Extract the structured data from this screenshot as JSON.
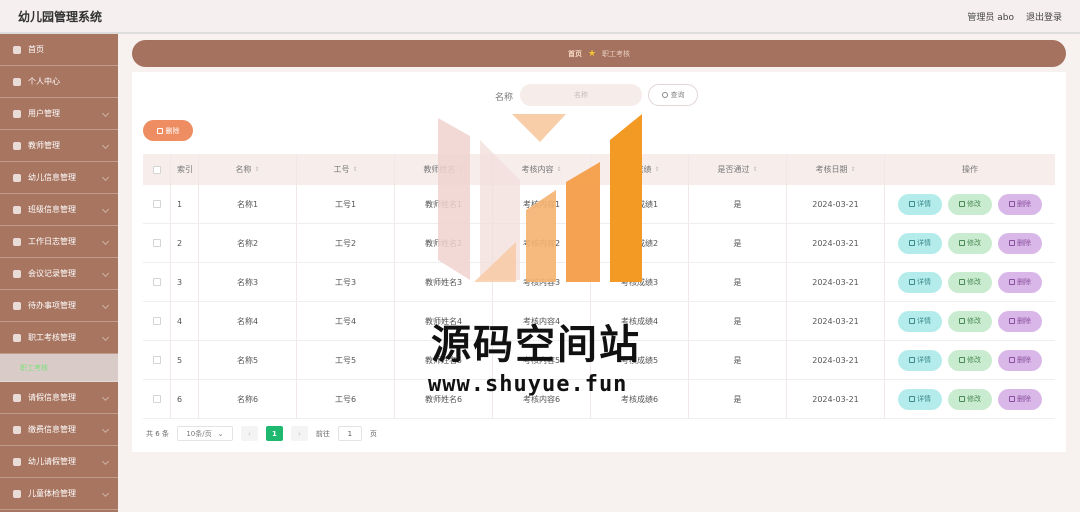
{
  "header": {
    "app_title": "幼儿园管理系统",
    "user_label": "管理员 abo",
    "logout_label": "退出登录"
  },
  "sidebar": {
    "items": [
      {
        "label": "首页"
      },
      {
        "label": "个人中心"
      },
      {
        "label": "用户管理"
      },
      {
        "label": "教师管理"
      },
      {
        "label": "幼儿信息管理"
      },
      {
        "label": "班级信息管理"
      },
      {
        "label": "工作日志管理"
      },
      {
        "label": "会议记录管理"
      },
      {
        "label": "待办事项管理"
      },
      {
        "label": "职工考核管理"
      },
      {
        "label": "职工考核",
        "sub": true
      },
      {
        "label": "请假信息管理"
      },
      {
        "label": "缴费信息管理"
      },
      {
        "label": "幼儿请假管理"
      },
      {
        "label": "儿童体检管理"
      }
    ]
  },
  "breadcrumb": {
    "home": "首页",
    "current": "职工考核"
  },
  "search": {
    "label": "名称",
    "placeholder": "名称",
    "button_label": "查询"
  },
  "toolbar": {
    "delete_label": "删除"
  },
  "table": {
    "headers": {
      "index": "索引",
      "name": "名称",
      "no": "工号",
      "teacher": "教师姓名",
      "content": "考核内容",
      "score": "考核成绩",
      "pass": "是否通过",
      "date": "考核日期",
      "ops": "操作"
    },
    "rows": [
      {
        "index": "1",
        "name": "名称1",
        "no": "工号1",
        "teacher": "教师姓名1",
        "content": "考核内容1",
        "score": "考核成绩1",
        "pass": "是",
        "date": "2024-03-21"
      },
      {
        "index": "2",
        "name": "名称2",
        "no": "工号2",
        "teacher": "教师姓名2",
        "content": "考核内容2",
        "score": "考核成绩2",
        "pass": "是",
        "date": "2024-03-21"
      },
      {
        "index": "3",
        "name": "名称3",
        "no": "工号3",
        "teacher": "教师姓名3",
        "content": "考核内容3",
        "score": "考核成绩3",
        "pass": "是",
        "date": "2024-03-21"
      },
      {
        "index": "4",
        "name": "名称4",
        "no": "工号4",
        "teacher": "教师姓名4",
        "content": "考核内容4",
        "score": "考核成绩4",
        "pass": "是",
        "date": "2024-03-21"
      },
      {
        "index": "5",
        "name": "名称5",
        "no": "工号5",
        "teacher": "教师姓名5",
        "content": "考核内容5",
        "score": "考核成绩5",
        "pass": "是",
        "date": "2024-03-21"
      },
      {
        "index": "6",
        "name": "名称6",
        "no": "工号6",
        "teacher": "教师姓名6",
        "content": "考核内容6",
        "score": "考核成绩6",
        "pass": "是",
        "date": "2024-03-21"
      }
    ],
    "op_labels": {
      "detail": "详情",
      "edit": "修改",
      "delete": "删除"
    }
  },
  "pagination": {
    "total_text": "共 6 条",
    "page_size": "10条/页",
    "current_page": "1",
    "goto_label": "前往",
    "goto_value": "1",
    "page_unit": "页"
  },
  "watermark": {
    "title": "源码空间站",
    "url": "www.shuyue.fun"
  },
  "colors": {
    "sidebar": "#a87560",
    "breadcrumb_bg": "#a57260",
    "delete_button": "#ee8d62",
    "pager_active": "#1fb86f",
    "op_detail": "#b4ecec",
    "op_edit": "#c9ecd0",
    "op_delete": "#d9b7e8"
  }
}
